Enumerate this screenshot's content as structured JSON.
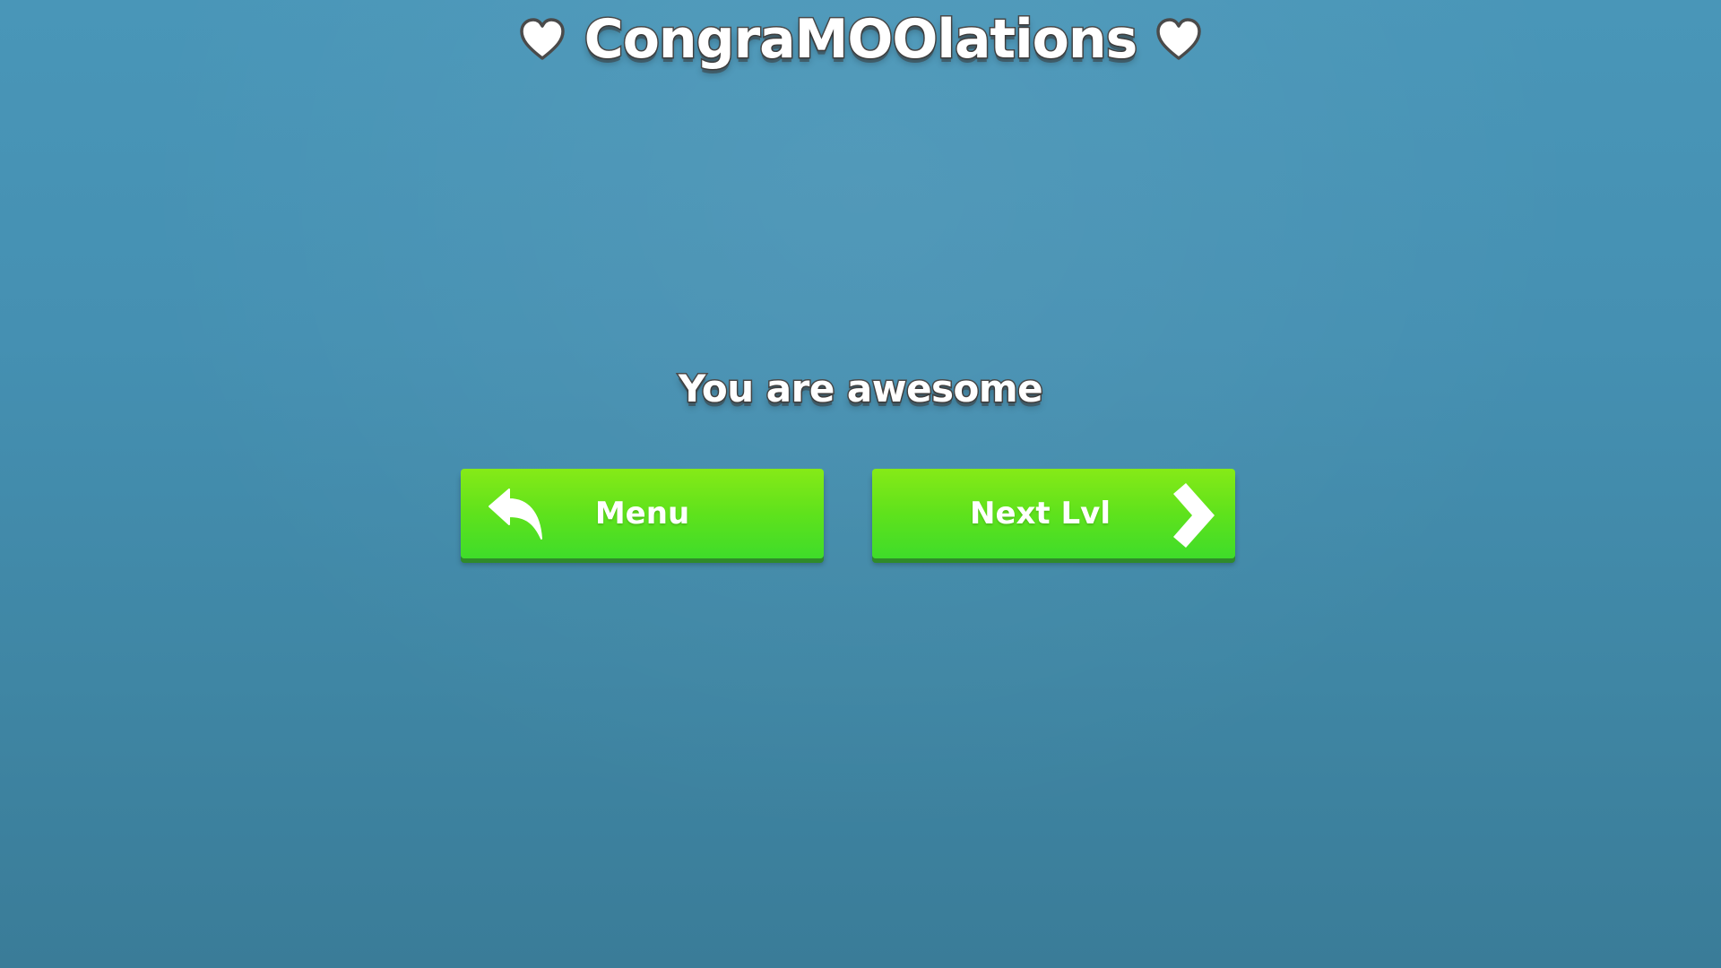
{
  "screen": {
    "title": "CongraMOOlations",
    "title_decoration_icon": "heart-icon",
    "message": "You are awesome"
  },
  "buttons": {
    "menu": {
      "label": "Menu",
      "icon": "back-arrow-icon"
    },
    "next": {
      "label": "Next Lvl",
      "icon": "chevron-right-icon"
    }
  },
  "colors": {
    "background": "#4590b2",
    "button_top": "#86ea17",
    "button_bottom": "#3fdc2a",
    "text": "#ffffff",
    "text_outline": "#4a4a4a"
  }
}
